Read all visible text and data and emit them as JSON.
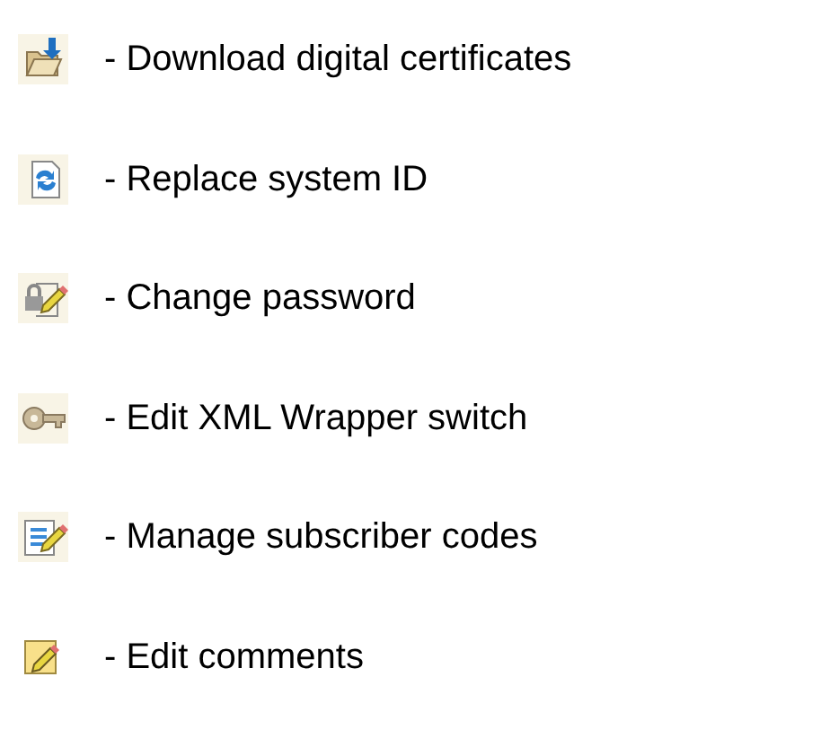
{
  "legend": [
    {
      "kind": "folder",
      "label": "- Download digital certificates"
    },
    {
      "kind": "refresh",
      "label": "- Replace system ID"
    },
    {
      "kind": "lock",
      "label": "- Change password"
    },
    {
      "kind": "key",
      "label": "- Edit XML Wrapper switch"
    },
    {
      "kind": "list",
      "label": "- Manage subscriber codes"
    },
    {
      "kind": "note",
      "label": "- Edit comments"
    }
  ]
}
